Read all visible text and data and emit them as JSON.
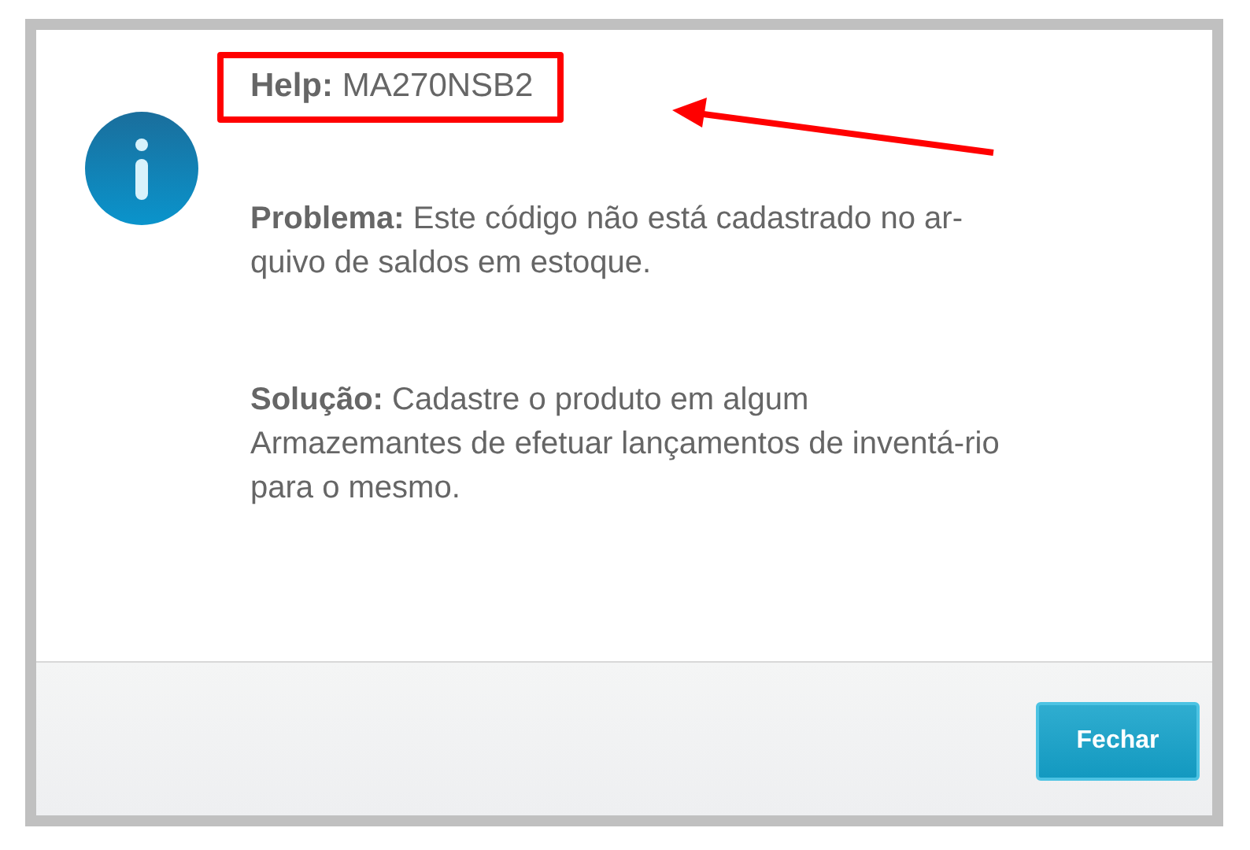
{
  "dialog": {
    "title": "**Help:** MA270NSB2",
    "paragraphs": [
      {
        "lines": [
          "**Problema:** Este código não está cadastrado no ar-",
          "quivo de saldos em estoque."
        ]
      },
      {
        "lines": [
          "**Solução:** Cadastre o produto em algum",
          "Armazemantes de efetuar lançamentos de inventá-rio",
          "para o mesmo."
        ]
      }
    ],
    "buttons": [
      {
        "label": "Fechar"
      }
    ]
  }
}
